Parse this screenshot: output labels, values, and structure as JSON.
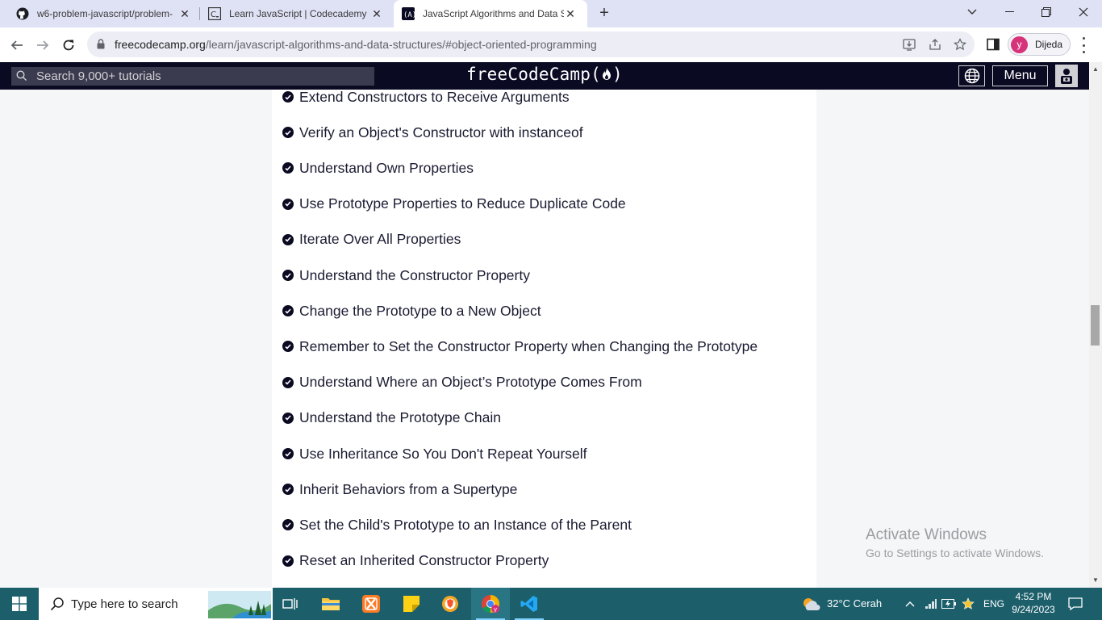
{
  "browser": {
    "tabs": [
      {
        "title": "w6-problem-javascript/problem-",
        "icon": "github-icon",
        "active": false
      },
      {
        "title": "Learn JavaScript | Codecademy",
        "icon": "codecademy-icon",
        "active": false
      },
      {
        "title": "JavaScript Algorithms and Data S",
        "icon": "freecodecamp-icon",
        "active": true
      }
    ],
    "url_host": "freecodecamp.org",
    "url_path": "/learn/javascript-algorithms-and-data-structures/#object-oriented-programming",
    "profile_initial": "y",
    "profile_name": "Dijeda"
  },
  "fcc_nav": {
    "search_placeholder": "Search 9,000+ tutorials",
    "logo": "freeCodeCamp(🔥)",
    "logo_text": "freeCodeCamp(",
    "logo_end": ")",
    "menu_label": "Menu"
  },
  "lessons": [
    "Extend Constructors to Receive Arguments",
    "Verify an Object's Constructor with instanceof",
    "Understand Own Properties",
    "Use Prototype Properties to Reduce Duplicate Code",
    "Iterate Over All Properties",
    "Understand the Constructor Property",
    "Change the Prototype to a New Object",
    "Remember to Set the Constructor Property when Changing the Prototype",
    "Understand Where an Object’s Prototype Comes From",
    "Understand the Prototype Chain",
    "Use Inheritance So You Don't Repeat Yourself",
    "Inherit Behaviors from a Supertype",
    "Set the Child's Prototype to an Instance of the Parent",
    "Reset an Inherited Constructor Property"
  ],
  "watermark": {
    "line1": "Activate Windows",
    "line2": "Go to Settings to activate Windows."
  },
  "taskbar": {
    "search_placeholder": "Type here to search",
    "weather": "32°C  Cerah",
    "language": "ENG",
    "time": "4:52 PM",
    "date": "9/24/2023"
  },
  "colors": {
    "fcc_dark": "#0a0a23",
    "tabstrip": "#dfe1f4",
    "taskbar": "#1c5f6b"
  }
}
